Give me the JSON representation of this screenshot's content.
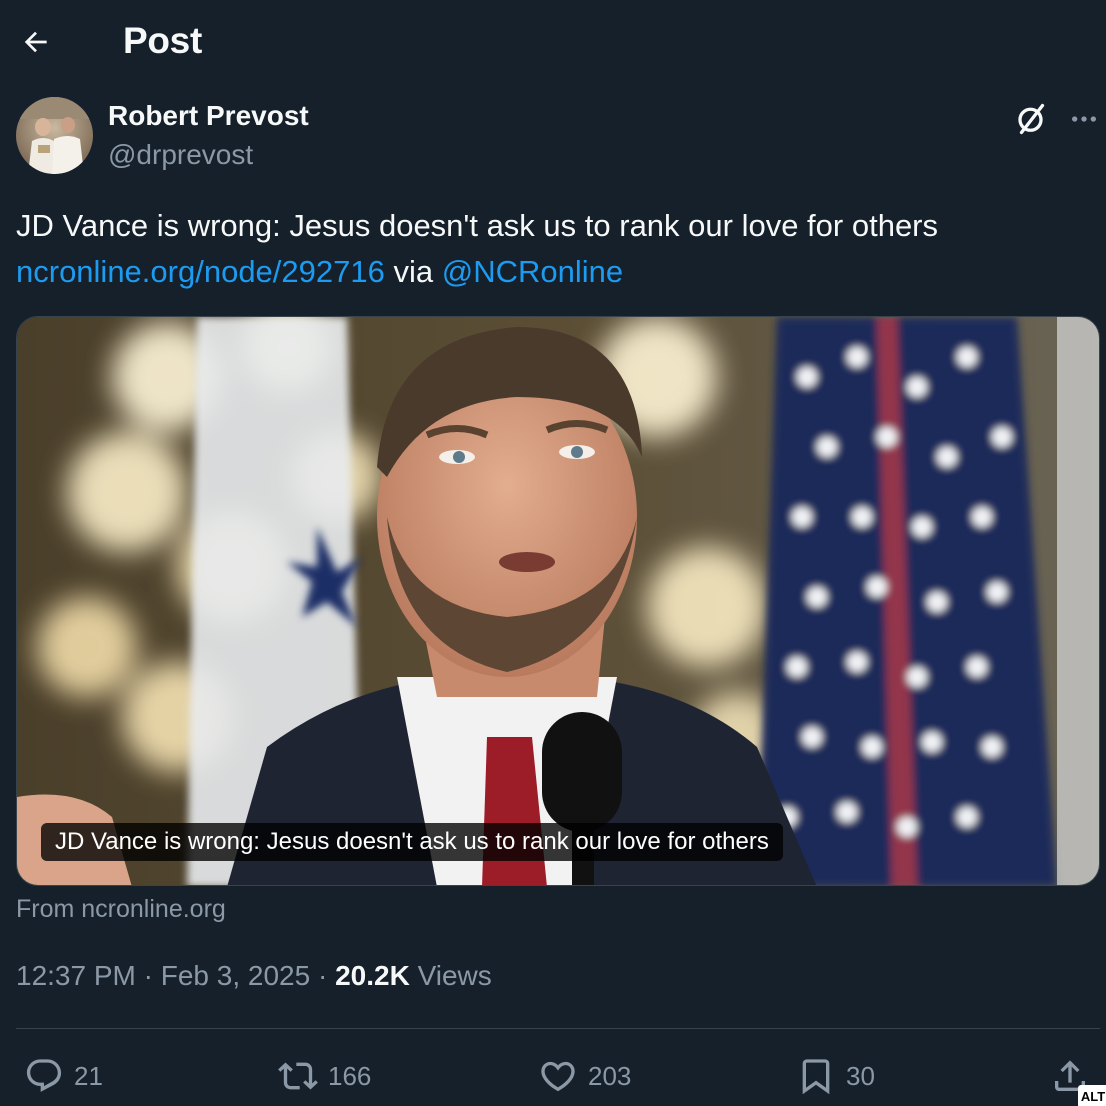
{
  "header": {
    "title": "Post"
  },
  "author": {
    "display_name": "Robert Prevost",
    "handle": "@drprevost"
  },
  "post": {
    "text": "JD Vance is wrong: Jesus doesn't ask us to rank our love for others",
    "link_text": "ncronline.org/node/292716",
    "via_text": "via",
    "mention": "@NCRonline"
  },
  "card": {
    "caption": "JD Vance is wrong: Jesus doesn't ask us to rank our love for others",
    "from": "From ncronline.org"
  },
  "meta": {
    "time": "12:37 PM",
    "separator": "·",
    "date": "Feb 3, 2025",
    "views_count": "20.2K",
    "views_label": "Views"
  },
  "actions": {
    "replies": "21",
    "reposts": "166",
    "likes": "203",
    "bookmarks": "30"
  },
  "alt_badge": "ALT",
  "colors": {
    "background": "#15202b",
    "text_primary": "#f7f9f9",
    "text_secondary": "#8b98a5",
    "link": "#1d9bf0",
    "border": "#38444d"
  },
  "icons": [
    "back-arrow-icon",
    "grok-icon",
    "more-icon",
    "reply-icon",
    "repost-icon",
    "like-icon",
    "bookmark-icon",
    "share-icon"
  ]
}
